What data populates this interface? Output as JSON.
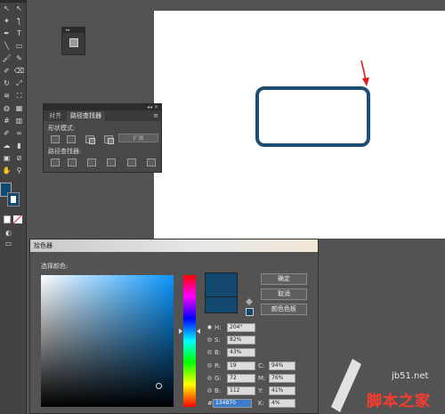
{
  "tools": {
    "icons": [
      "selection-tool",
      "direct-selection-tool",
      "magic-wand-tool",
      "lasso-tool",
      "pen-tool",
      "type-tool",
      "line-tool",
      "rectangle-tool",
      "paintbrush-tool",
      "pencil-tool",
      "blob-brush-tool",
      "eraser-tool",
      "rotate-tool",
      "scale-tool",
      "width-tool",
      "free-transform-tool",
      "shape-builder-tool",
      "perspective-grid-tool",
      "mesh-tool",
      "gradient-tool",
      "eyedropper-tool",
      "blend-tool",
      "symbol-sprayer-tool",
      "column-graph-tool",
      "artboard-tool",
      "slice-tool",
      "hand-tool",
      "zoom-tool"
    ],
    "glyphs": [
      "↖",
      "↖",
      "✦",
      "ƪ",
      "✒",
      "T",
      "╲",
      "▭",
      "🖌",
      "✎",
      "✐",
      "⌫",
      "↻",
      "⤢",
      "≋",
      "⛶",
      "◍",
      "▦",
      "#",
      "▥",
      "✐",
      "∞",
      "☁",
      "▮",
      "▣",
      "⊘",
      "✋",
      "⚲"
    ],
    "fill_color": "#134870"
  },
  "pathfinder": {
    "tabs": [
      "对齐",
      "路径查找器"
    ],
    "shape_modes_label": "形状模式:",
    "pathfinders_label": "路径查找器:",
    "expand_label": "扩展"
  },
  "canvas": {
    "shape_stroke_color": "#1c4e72",
    "arrow_color": "#e01818"
  },
  "color_picker": {
    "title": "拾色器",
    "select_color_label": "选择颜色:",
    "ok_label": "确定",
    "cancel_label": "取消",
    "swatches_label": "颜色色板",
    "hsb": [
      {
        "label": "H:",
        "value": "204°",
        "selected": true
      },
      {
        "label": "S:",
        "value": "82%",
        "selected": false
      },
      {
        "label": "B:",
        "value": "43%",
        "selected": false
      }
    ],
    "rgb": [
      {
        "label": "R:",
        "value": "19"
      },
      {
        "label": "G:",
        "value": "72"
      },
      {
        "label": "B:",
        "value": "112"
      }
    ],
    "cmyk": [
      {
        "label": "C:",
        "value": "94%"
      },
      {
        "label": "M:",
        "value": "76%"
      },
      {
        "label": "Y:",
        "value": "41%"
      },
      {
        "label": "K:",
        "value": "4%"
      }
    ],
    "hex_prefix": "#",
    "hex_value": "134870"
  },
  "watermark": {
    "site": "jb51.net",
    "brand": "脚本之家"
  }
}
